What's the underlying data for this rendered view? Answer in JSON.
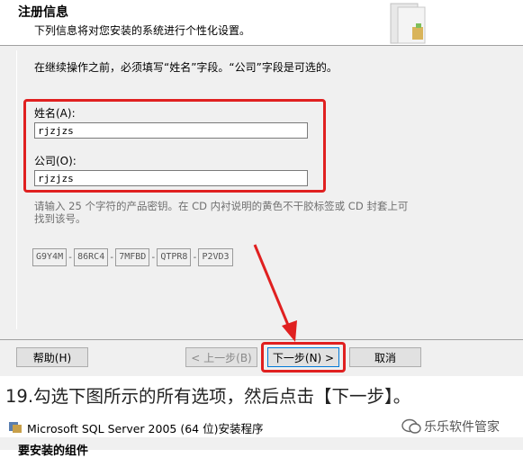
{
  "header": {
    "title": "注册信息",
    "subtitle": "下列信息将对您安装的系统进行个性化设置。"
  },
  "form": {
    "instruction": "在继续操作之前，必须填写“姓名”字段。“公司”字段是可选的。",
    "name_label": "姓名(A):",
    "name_value": "rjzjzs",
    "company_label": "公司(O):",
    "company_value": "rjzjzs",
    "key_hint": "请输入 25 个字符的产品密钥。在 CD 内衬说明的黄色不干胶标签或 CD 封套上可找到该号。",
    "product_key": [
      "G9Y4M",
      "86RC4",
      "7MFBD",
      "QTPR8",
      "P2VD3"
    ]
  },
  "buttons": {
    "help": "帮助(H)",
    "back": "< 上一步(B)",
    "next": "下一步(N) >",
    "cancel": "取消"
  },
  "caption": "19.勾选下图所示的所有选项，然后点击【下一步】。",
  "second_window": {
    "title": "Microsoft SQL Server 2005 (64 位)安装程序",
    "subtitle": "要安装的组件"
  },
  "watermark": "乐乐软件管家",
  "colors": {
    "highlight": "#e02020",
    "focus_border": "#0078d7"
  }
}
